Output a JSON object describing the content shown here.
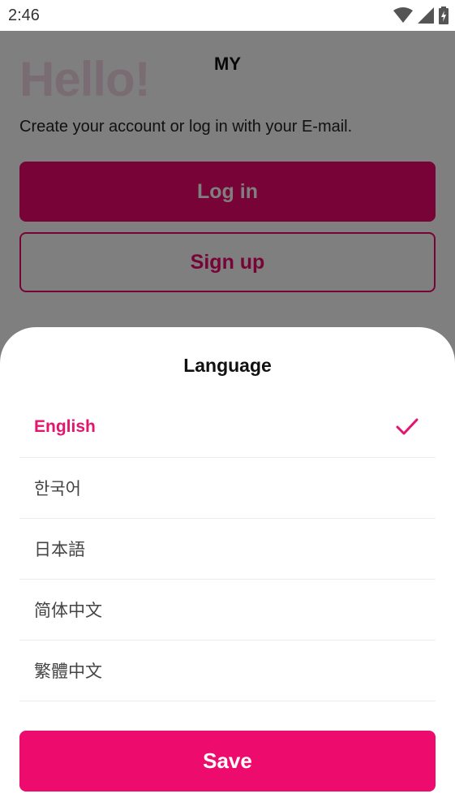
{
  "status_bar": {
    "time": "2:46",
    "icons": [
      "wifi-icon",
      "signal-icon",
      "battery-icon"
    ]
  },
  "page": {
    "header_title": "MY",
    "hello": "Hello!",
    "subtitle": "Create your account or log in with your E-mail.",
    "login_label": "Log in",
    "signup_label": "Sign up"
  },
  "language_sheet": {
    "title": "Language",
    "items": [
      {
        "label": "English",
        "selected": true
      },
      {
        "label": "한국어",
        "selected": false
      },
      {
        "label": "日本語",
        "selected": false
      },
      {
        "label": "简体中文",
        "selected": false
      },
      {
        "label": "繁體中文",
        "selected": false
      }
    ],
    "save_label": "Save"
  },
  "colors": {
    "accent": "#ee0b6e",
    "selected_text": "#e2166f",
    "scrim": "rgba(0,0,0,0.5)"
  }
}
